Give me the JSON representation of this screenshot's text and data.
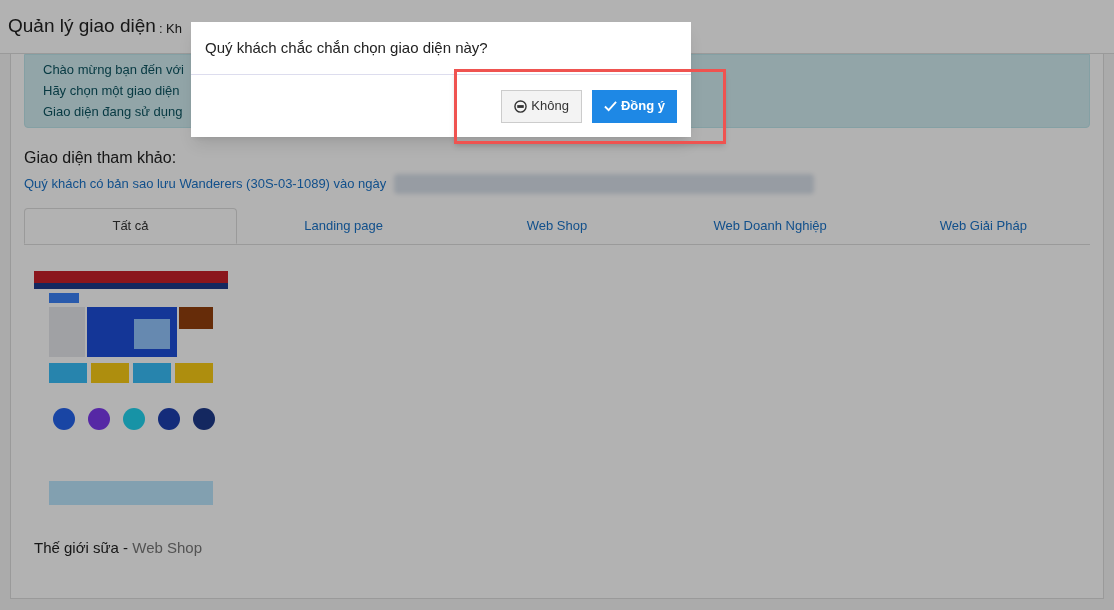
{
  "header": {
    "title": "Quản lý giao diện",
    "subtitle": ": Kh"
  },
  "info_lines": [
    "Chào mừng bạn đến với",
    "Hãy chọn một giao diện",
    "Giao diện đang sử dụng"
  ],
  "section_title": "Giao diện tham khảo:",
  "backup_link": "Quý khách có bản sao lưu Wanderers (30S-03-1089) vào ngày",
  "tabs": [
    {
      "label": "Tất cả",
      "selected": true
    },
    {
      "label": "Landing page",
      "selected": false
    },
    {
      "label": "Web Shop",
      "selected": false
    },
    {
      "label": "Web Doanh Nghiệp",
      "selected": false
    },
    {
      "label": "Web Giải Pháp",
      "selected": false
    }
  ],
  "themes": [
    {
      "kind": "picture",
      "name": "Thế giới sữa - ",
      "category": "Web Shop"
    }
  ],
  "dialog": {
    "message": "Quý khách chắc chắn chọn giao diện này?",
    "buttons": [
      {
        "kind": "cancel",
        "label": "Không"
      },
      {
        "kind": "confirm",
        "label": "Đồng ý"
      }
    ],
    "highlighted": true
  }
}
